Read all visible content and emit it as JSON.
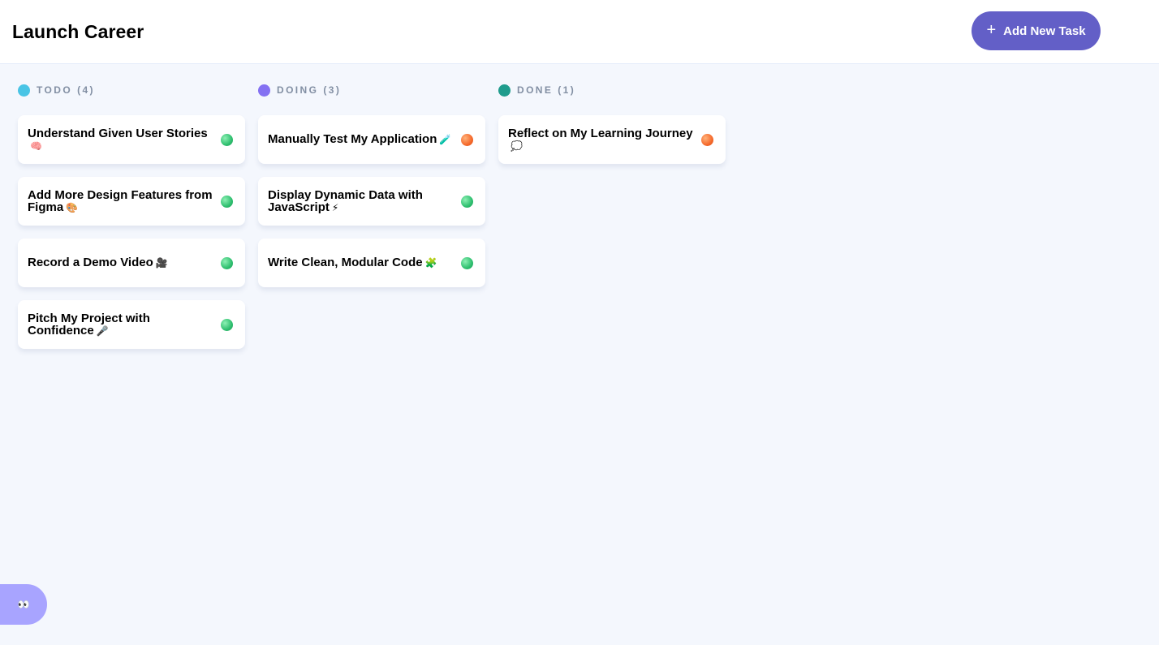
{
  "header": {
    "board_title": "Launch Career",
    "add_button": {
      "icon": "plus-icon",
      "icon_glyph": "+",
      "label": "Add New Task"
    }
  },
  "columns": [
    {
      "name": "TODO",
      "count": "(4)",
      "color": "#49c4e5",
      "tasks": [
        {
          "title": "Understand Given User Stories",
          "emoji": "🧠",
          "status_color": "green"
        },
        {
          "title": "Add More Design Features from Figma",
          "emoji": "🎨",
          "status_color": "green"
        },
        {
          "title": "Record a Demo Video",
          "emoji": "🎥",
          "status_color": "green"
        },
        {
          "title": "Pitch My Project with Confidence",
          "emoji": "🎤",
          "status_color": "green"
        }
      ]
    },
    {
      "name": "DOING",
      "count": "(3)",
      "color": "#8471f2",
      "tasks": [
        {
          "title": "Manually Test My Application",
          "emoji": "🧪",
          "status_color": "orange"
        },
        {
          "title": "Display Dynamic Data with JavaScript",
          "emoji": "⚡",
          "status_color": "green"
        },
        {
          "title": "Write Clean, Modular Code",
          "emoji": "🧩",
          "status_color": "green"
        }
      ]
    },
    {
      "name": "DONE",
      "count": "(1)",
      "color": "#1f9c8d",
      "tasks": [
        {
          "title": "Reflect on My Learning Journey",
          "emoji": "💭",
          "status_color": "orange"
        }
      ]
    }
  ],
  "sidebar_toggle": {
    "icon": "eye-icon",
    "glyph": "👀"
  },
  "colors": {
    "accent": "#635fc7",
    "background": "#f4f7fd",
    "muted_text": "#828fa3"
  }
}
